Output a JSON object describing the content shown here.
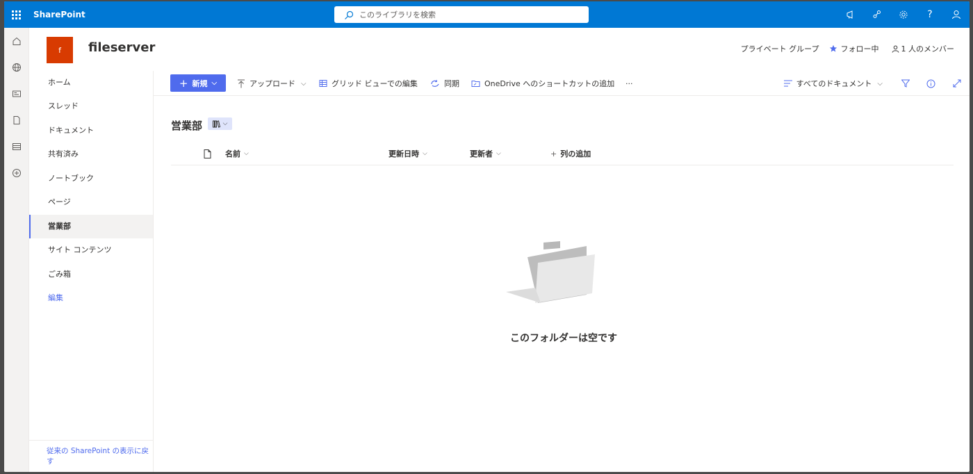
{
  "suitebar": {
    "app_name": "SharePoint",
    "search_placeholder": "このライブラリを検索"
  },
  "site": {
    "logo_letter": "f",
    "title": "fileserver",
    "privacy": "プライベート グループ",
    "follow_label": "フォロー中",
    "members_label": "1 人のメンバー"
  },
  "nav": {
    "items": [
      {
        "label": "ホーム"
      },
      {
        "label": "スレッド"
      },
      {
        "label": "ドキュメント"
      },
      {
        "label": "共有済み"
      },
      {
        "label": "ノートブック"
      },
      {
        "label": "ページ"
      },
      {
        "label": "営業部",
        "active": true
      },
      {
        "label": "サイト コンテンツ"
      },
      {
        "label": "ごみ箱"
      }
    ],
    "edit_label": "編集",
    "footer_link": "従来の SharePoint の表示に戻す"
  },
  "command_bar": {
    "new_label": "新規",
    "upload_label": "アップロード",
    "grid_edit_label": "グリッド ビューでの編集",
    "sync_label": "同期",
    "shortcut_label": "OneDrive へのショートカットの追加",
    "more_label": "···",
    "view_label": "すべてのドキュメント"
  },
  "library": {
    "title": "営業部",
    "columns": {
      "name": "名前",
      "modified": "更新日時",
      "modified_by": "更新者",
      "add_column": "列の追加"
    },
    "empty_message": "このフォルダーは空です"
  },
  "colors": {
    "suitebar": "#0078d4",
    "accent": "#4f6bed",
    "logo": "#d83b01"
  }
}
